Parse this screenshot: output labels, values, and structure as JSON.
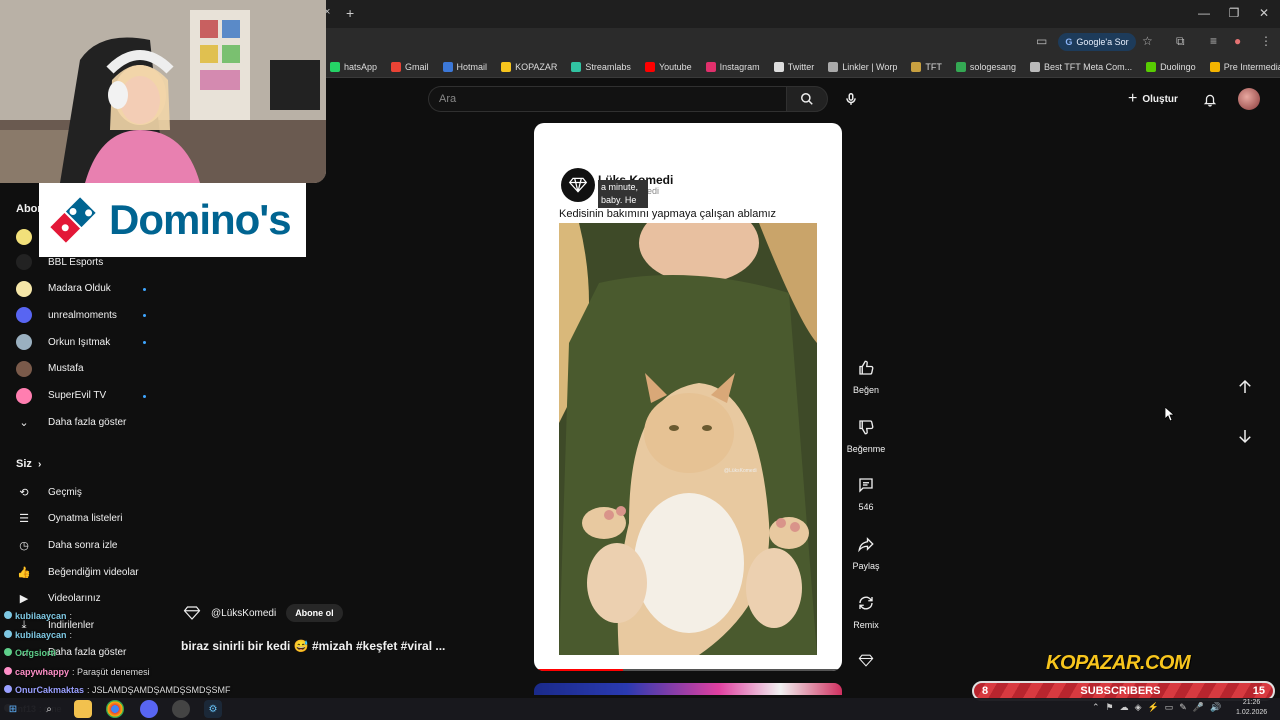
{
  "browser": {
    "new_tab_symbol": "+",
    "close_tab_symbol": "×",
    "google_button": "Google'a Sor",
    "window_controls": [
      "—",
      "❐",
      "✕"
    ],
    "bookmarks": [
      {
        "label": "hatsApp",
        "color": "#25d366"
      },
      {
        "label": "Gmail",
        "color": "#ea4335"
      },
      {
        "label": "Hotmail",
        "color": "#3c78d8"
      },
      {
        "label": "KOPAZAR",
        "color": "#f7c51d"
      },
      {
        "label": "Streamlabs",
        "color": "#31c3a2"
      },
      {
        "label": "Youtube",
        "color": "#ff0000"
      },
      {
        "label": "Instagram",
        "color": "#e1306c"
      },
      {
        "label": "Twitter",
        "color": "#dddddd"
      },
      {
        "label": "Linkler | Worp",
        "color": "#aaaaaa"
      },
      {
        "label": "TFT",
        "color": "#c8a040"
      },
      {
        "label": "sologesang",
        "color": "#34a853"
      },
      {
        "label": "Best TFT Meta Com...",
        "color": "#bbbbbb"
      },
      {
        "label": "Duolingo",
        "color": "#58cc02"
      },
      {
        "label": "Pre Intermediate (B...",
        "color": "#f4b400"
      }
    ]
  },
  "youtube": {
    "search_placeholder": "Ara",
    "create_label": "Oluştur",
    "sidebar": {
      "abone_partial": "Abon",
      "subscriptions": [
        {
          "label": "BBL Esports",
          "icon_color": "#222222",
          "dot": false
        },
        {
          "label": "Madara Olduk",
          "icon_color": "#f5e6a8",
          "dot": true
        },
        {
          "label": "unrealmoments",
          "icon_color": "#5865f2",
          "dot": true
        },
        {
          "label": "Orkun Işıtmak",
          "icon_color": "#9ab0c0",
          "dot": true
        },
        {
          "label": "Mustafa",
          "icon_color": "#7a5a4a",
          "dot": false
        },
        {
          "label": "SuperEvil TV",
          "icon_color": "#ff7eb0",
          "dot": true
        }
      ],
      "show_more": "Daha fazla göster",
      "you_section": "Siz",
      "you_items": [
        {
          "label": "Geçmiş",
          "icon": "history-icon"
        },
        {
          "label": "Oynatma listeleri",
          "icon": "playlists-icon"
        },
        {
          "label": "Daha sonra izle",
          "icon": "clock-icon"
        },
        {
          "label": "Beğendiğim videolar",
          "icon": "like-icon"
        },
        {
          "label": "Videolarınız",
          "icon": "video-icon"
        },
        {
          "label": "İndirilenler",
          "icon": "download-icon"
        },
        {
          "label": "Daha fazla göster",
          "icon": "chevron-down-icon"
        }
      ]
    },
    "short": {
      "channel_name": "Lüks Komedi",
      "channel_sub_partial": "edi",
      "caption_overlay": "a minute, baby.  He",
      "title": "Kedisinin bakımını yapmaya çalışan ablamız",
      "watermark": "@LüksKomedi",
      "handle": "@LüksKomedi",
      "subscribe_label": "Abone ol",
      "description": "biraz sinirli bir kedi 😅 #mizah #keşfet #viral ...",
      "progress": 0.29
    },
    "actions": [
      {
        "label": "Beğen",
        "icon": "like-icon"
      },
      {
        "label": "Beğenme",
        "icon": "dislike-icon"
      },
      {
        "label": "546",
        "icon": "comment-icon"
      },
      {
        "label": "Paylaş",
        "icon": "share-icon"
      },
      {
        "label": "Remix",
        "icon": "remix-icon"
      }
    ]
  },
  "overlay": {
    "sponsor": "Domino's",
    "sponsor_color": "#006491",
    "kopazar": "KOPAZAR.COM",
    "subscribers_label": "SUBSCRIBERS",
    "subscribers_current": "8",
    "subscribers_goal": "15",
    "chat": [
      {
        "user": "kubilaaycan",
        "text": ":",
        "color": "#7ec8e3"
      },
      {
        "user": "kubilaaycan",
        "text": ":",
        "color": "#7ec8e3"
      },
      {
        "user": "Orfgsiorti",
        "text": "",
        "color": "#5ecf8a"
      },
      {
        "user": "capywhappy",
        "text": ": Paraşüt denemesi",
        "color": "#ff8fc8"
      },
      {
        "user": "OnurCakmaktas",
        "text": ": JSLAMDŞAMDŞAMDŞSMDŞSMF",
        "color": "#9aa0ff"
      },
      {
        "user": "inf13",
        "text": ": o ne",
        "color": "#dddddd"
      }
    ]
  },
  "taskbar": {
    "time": "21:26",
    "date": "1.02.2026"
  }
}
